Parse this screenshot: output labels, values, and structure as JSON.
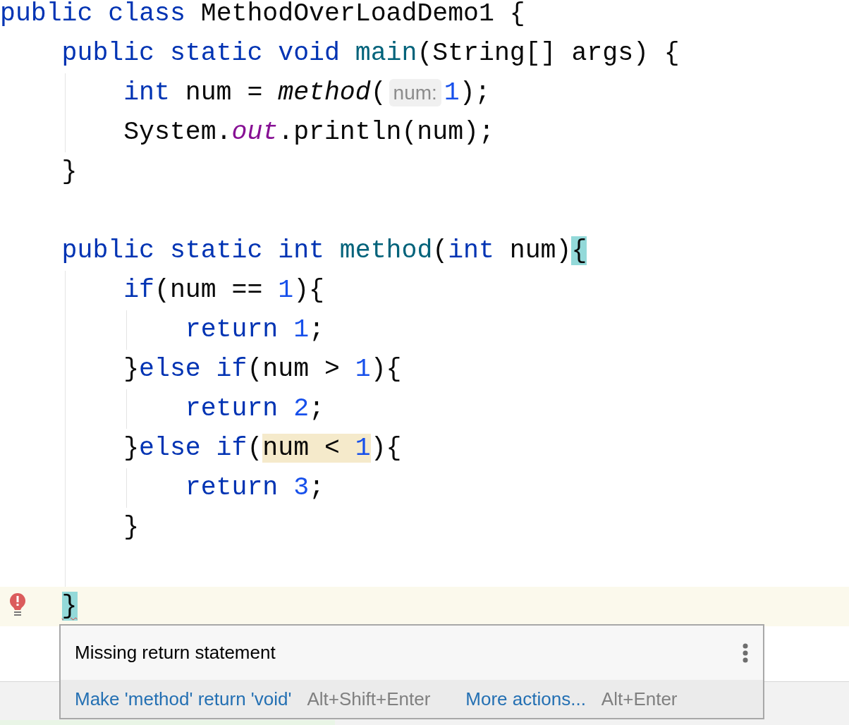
{
  "code": [
    {
      "kind": "code",
      "tokens": [
        {
          "kind": "keyword",
          "text": "public class "
        },
        {
          "kind": "plain",
          "text": "MethodOverLoadDemo1 {"
        }
      ],
      "children": [
        {
          "kind": "code",
          "tokens": [
            {
              "kind": "keyword",
              "text": "public static void "
            },
            {
              "kind": "declaration",
              "text": "main"
            },
            {
              "kind": "plain",
              "text": "(String[] args) {"
            }
          ],
          "children": [
            {
              "kind": "code",
              "tokens": [
                {
                  "kind": "keyword",
                  "text": "int "
                },
                {
                  "kind": "plain",
                  "text": "num = "
                },
                {
                  "kind": "static-call",
                  "text": "method"
                },
                {
                  "kind": "plain",
                  "text": "("
                },
                {
                  "kind": "hint",
                  "text": "num:"
                },
                {
                  "kind": "number",
                  "text": "1"
                },
                {
                  "kind": "plain",
                  "text": ");"
                }
              ]
            },
            {
              "kind": "code",
              "tokens": [
                {
                  "kind": "plain",
                  "text": "System."
                },
                {
                  "kind": "field",
                  "text": "out"
                },
                {
                  "kind": "plain",
                  "text": ".println(num);"
                }
              ]
            }
          ]
        },
        {
          "kind": "code",
          "tokens": [
            {
              "kind": "plain",
              "text": "}"
            }
          ]
        },
        {
          "kind": "blank"
        },
        {
          "kind": "code",
          "tokens": [
            {
              "kind": "keyword",
              "text": "public static int "
            },
            {
              "kind": "declaration",
              "text": "method"
            },
            {
              "kind": "plain",
              "text": "("
            },
            {
              "kind": "keyword",
              "text": "int "
            },
            {
              "kind": "plain",
              "text": "num)"
            },
            {
              "kind": "plain",
              "text": "{",
              "brace_match": true
            }
          ],
          "children": [
            {
              "kind": "code",
              "tokens": [
                {
                  "kind": "keyword",
                  "text": "if"
                },
                {
                  "kind": "plain",
                  "text": "(num == "
                },
                {
                  "kind": "number",
                  "text": "1"
                },
                {
                  "kind": "plain",
                  "text": "){"
                }
              ],
              "children": [
                {
                  "kind": "code",
                  "tokens": [
                    {
                      "kind": "keyword",
                      "text": "return "
                    },
                    {
                      "kind": "number",
                      "text": "1"
                    },
                    {
                      "kind": "plain",
                      "text": ";"
                    }
                  ]
                }
              ]
            },
            {
              "kind": "code",
              "tokens": [
                {
                  "kind": "plain",
                  "text": "}"
                },
                {
                  "kind": "keyword",
                  "text": "else if"
                },
                {
                  "kind": "plain",
                  "text": "(num > "
                },
                {
                  "kind": "number",
                  "text": "1"
                },
                {
                  "kind": "plain",
                  "text": "){"
                }
              ],
              "children": [
                {
                  "kind": "code",
                  "tokens": [
                    {
                      "kind": "keyword",
                      "text": "return "
                    },
                    {
                      "kind": "number",
                      "text": "2"
                    },
                    {
                      "kind": "plain",
                      "text": ";"
                    }
                  ]
                }
              ]
            },
            {
              "kind": "code",
              "tokens": [
                {
                  "kind": "plain",
                  "text": "}"
                },
                {
                  "kind": "keyword",
                  "text": "else if"
                },
                {
                  "kind": "plain",
                  "text": "("
                },
                {
                  "kind": "plain",
                  "text": "num < ",
                  "warning": true
                },
                {
                  "kind": "number",
                  "text": "1",
                  "warning": true
                },
                {
                  "kind": "plain",
                  "text": "){"
                }
              ],
              "children": [
                {
                  "kind": "code",
                  "tokens": [
                    {
                      "kind": "keyword",
                      "text": "return "
                    },
                    {
                      "kind": "number",
                      "text": "3"
                    },
                    {
                      "kind": "plain",
                      "text": ";"
                    }
                  ]
                }
              ]
            },
            {
              "kind": "code",
              "tokens": [
                {
                  "kind": "plain",
                  "text": "}"
                }
              ]
            },
            {
              "kind": "blank"
            }
          ]
        },
        {
          "kind": "code",
          "error": true,
          "tokens": [
            {
              "kind": "plain",
              "text": "}",
              "brace_match": true,
              "error": true
            }
          ]
        }
      ]
    }
  ],
  "popup": {
    "message": "Missing return statement",
    "actions": [
      {
        "label": "Make 'method' return 'void'",
        "shortcut": "Alt+Shift+Enter"
      },
      {
        "label": "More actions...",
        "shortcut": "Alt+Enter"
      }
    ]
  }
}
